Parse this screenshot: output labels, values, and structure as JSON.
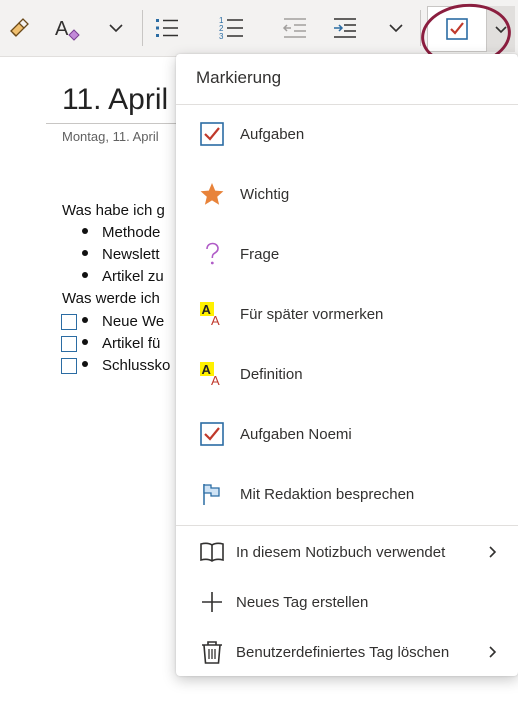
{
  "toolbar": {
    "buttons": [
      {
        "name": "format-painter-icon"
      },
      {
        "name": "clear-formatting-icon"
      },
      {
        "name": "chevron-down-icon"
      },
      {
        "name": "bullet-list-icon"
      },
      {
        "name": "numbered-list-icon"
      },
      {
        "name": "decrease-indent-icon"
      },
      {
        "name": "increase-indent-icon"
      },
      {
        "name": "chevron-down-icon"
      },
      {
        "name": "todo-tag-icon"
      }
    ],
    "accent": "#2b6ca3",
    "highlight_circle_color": "#8b1e3f"
  },
  "page": {
    "title": "11. April",
    "date": "Montag, 11. April",
    "lines": [
      "Was habe ich g",
      "Methode",
      "Newslett",
      "Artikel zu",
      "Was werde ich",
      "Neue We",
      "Artikel fü",
      "Schlussko"
    ]
  },
  "menu": {
    "header": "Markierung",
    "tags": [
      {
        "label": "Aufgaben",
        "icon": "checkbox-checked-icon"
      },
      {
        "label": "Wichtig",
        "icon": "star-icon"
      },
      {
        "label": "Frage",
        "icon": "question-mark-icon"
      },
      {
        "label": "Für später vormerken",
        "icon": "highlight-text-icon"
      },
      {
        "label": "Definition",
        "icon": "highlight-text-icon"
      },
      {
        "label": "Aufgaben Noemi",
        "icon": "checkbox-checked-icon"
      },
      {
        "label": "Mit Redaktion besprechen",
        "icon": "flag-icon"
      }
    ],
    "actions": [
      {
        "label": "In diesem Notizbuch verwendet",
        "icon": "book-icon",
        "has_submenu": true
      },
      {
        "label": "Neues Tag erstellen",
        "icon": "plus-icon",
        "has_submenu": false
      },
      {
        "label": "Benutzerdefiniertes Tag löschen",
        "icon": "trash-icon",
        "has_submenu": true
      }
    ],
    "colors": {
      "check_mark": "#c0392b",
      "checkbox_border": "#2b6ca3",
      "star": "#e8833a",
      "question": "#b05cc7",
      "highlight": "#fff100",
      "flag": "#2b6ca3"
    }
  }
}
